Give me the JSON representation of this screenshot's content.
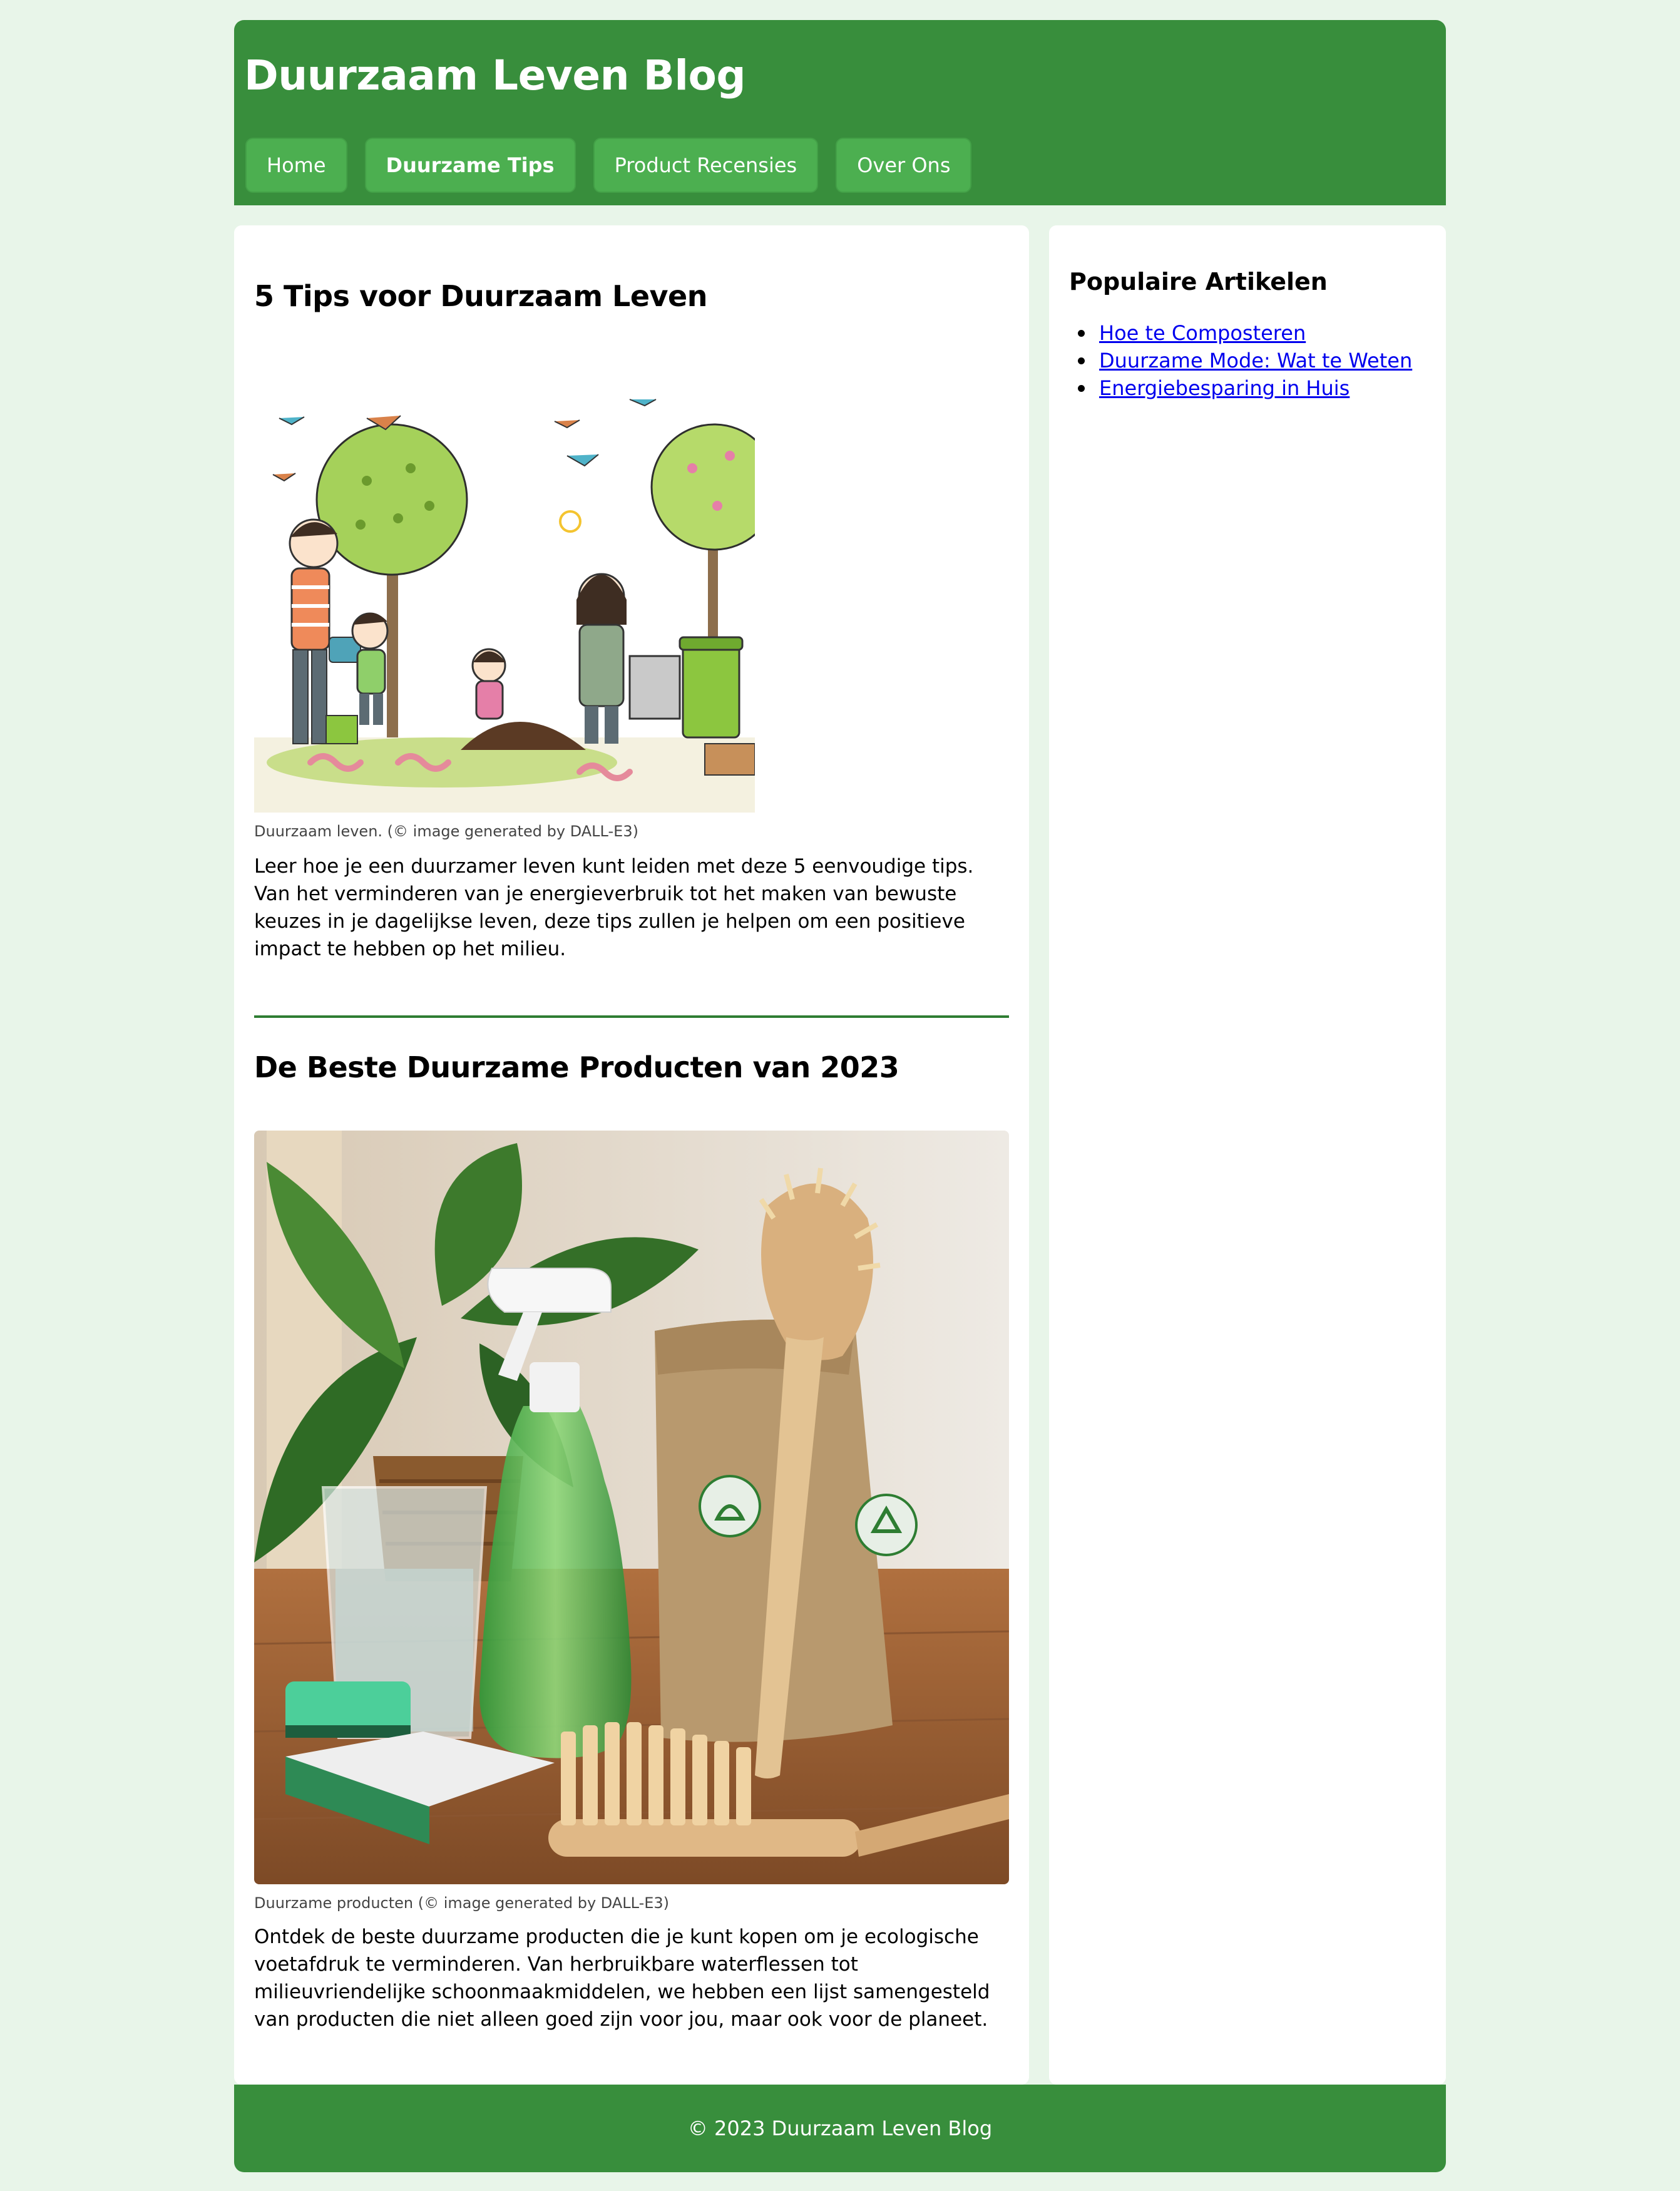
{
  "header": {
    "title": "Duurzaam Leven Blog",
    "nav": [
      {
        "label": "Home"
      },
      {
        "label": "Duurzame Tips"
      },
      {
        "label": "Product Recensies"
      },
      {
        "label": "Over Ons"
      }
    ],
    "active_nav": "Duurzame Tips"
  },
  "articles": [
    {
      "title": "5 Tips voor Duurzaam Leven",
      "image_caption": "Duurzaam leven. (© image generated by DALL-E3)",
      "body": "Leer hoe je een duurzamer leven kunt leiden met deze 5 eenvoudige tips. Van het verminderen van je energieverbruik tot het maken van bewuste keuzes in je dagelijkse leven, deze tips zullen je helpen om een positieve impact te hebben op het milieu."
    },
    {
      "title": "De Beste Duurzame Producten van 2023",
      "image_caption": "Duurzame producten (© image generated by DALL-E3)",
      "body": "Ontdek de beste duurzame producten die je kunt kopen om je ecologische voetafdruk te verminderen. Van herbruikbare waterflessen tot milieuvriendelijke schoonmaakmiddelen, we hebben een lijst samengesteld van producten die niet alleen goed zijn voor jou, maar ook voor de planeet."
    }
  ],
  "sidebar": {
    "title": "Populaire Artikelen",
    "links": [
      {
        "label": "Hoe te Composteren"
      },
      {
        "label": "Duurzame Mode: Wat te Weten"
      },
      {
        "label": "Energiebesparing in Huis"
      }
    ]
  },
  "footer": {
    "text": "© 2023 Duurzaam Leven Blog"
  },
  "colors": {
    "page_background": "#e8f5e9",
    "header_green": "#388e3c",
    "nav_button_green": "#4caf50",
    "divider_green": "#2e7d32",
    "link_blue": "#0000ee"
  }
}
